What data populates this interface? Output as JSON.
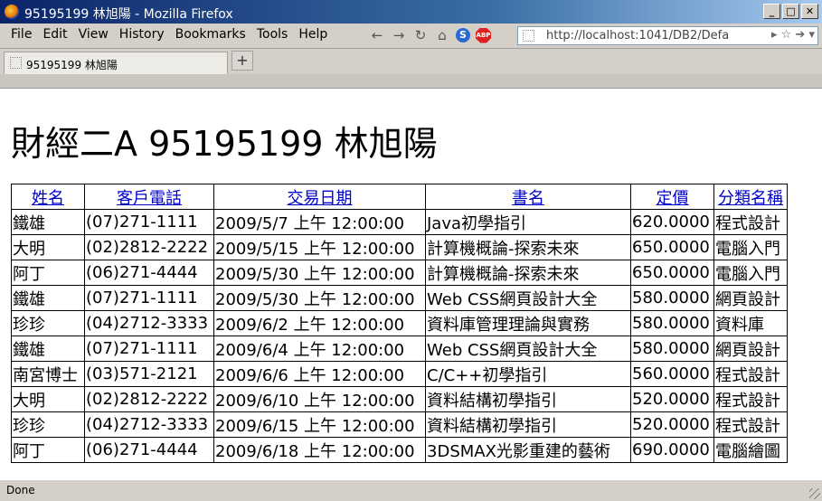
{
  "window": {
    "title": "95195199 林旭陽 - Mozilla Firefox"
  },
  "menu": [
    "File",
    "Edit",
    "View",
    "History",
    "Bookmarks",
    "Tools",
    "Help"
  ],
  "address": {
    "url": "http://localhost:1041/DB2/Defa"
  },
  "tab": {
    "label": "95195199 林旭陽"
  },
  "page": {
    "heading": "財經二A 95195199 林旭陽",
    "table": {
      "headers": [
        "姓名",
        "客戶電話",
        "交易日期",
        "書名",
        "定價",
        "分類名稱"
      ],
      "rows": [
        [
          "鐵雄",
          "(07)271-1111",
          "2009/5/7 上午 12:00:00",
          "Java初學指引",
          "620.0000",
          "程式設計"
        ],
        [
          "大明",
          "(02)2812-2222",
          "2009/5/15 上午 12:00:00",
          "計算機概論-探索未來",
          "650.0000",
          "電腦入門"
        ],
        [
          "阿丁",
          "(06)271-4444",
          "2009/5/30 上午 12:00:00",
          "計算機概論-探索未來",
          "650.0000",
          "電腦入門"
        ],
        [
          "鐵雄",
          "(07)271-1111",
          "2009/5/30 上午 12:00:00",
          "Web CSS網頁設計大全",
          "580.0000",
          "網頁設計"
        ],
        [
          "珍珍",
          "(04)2712-3333",
          "2009/6/2 上午 12:00:00",
          "資料庫管理理論與實務",
          "580.0000",
          "資料庫"
        ],
        [
          "鐵雄",
          "(07)271-1111",
          "2009/6/4 上午 12:00:00",
          "Web CSS網頁設計大全",
          "580.0000",
          "網頁設計"
        ],
        [
          "南宮博士",
          "(03)571-2121",
          "2009/6/6 上午 12:00:00",
          "C/C++初學指引",
          "560.0000",
          "程式設計"
        ],
        [
          "大明",
          "(02)2812-2222",
          "2009/6/10 上午 12:00:00",
          "資料結構初學指引",
          "520.0000",
          "程式設計"
        ],
        [
          "珍珍",
          "(04)2712-3333",
          "2009/6/15 上午 12:00:00",
          "資料結構初學指引",
          "520.0000",
          "程式設計"
        ],
        [
          "阿丁",
          "(06)271-4444",
          "2009/6/18 上午 12:00:00",
          "3DSMAX光影重建的藝術",
          "690.0000",
          "電腦繪圖"
        ]
      ]
    }
  },
  "status": {
    "text": "Done"
  }
}
